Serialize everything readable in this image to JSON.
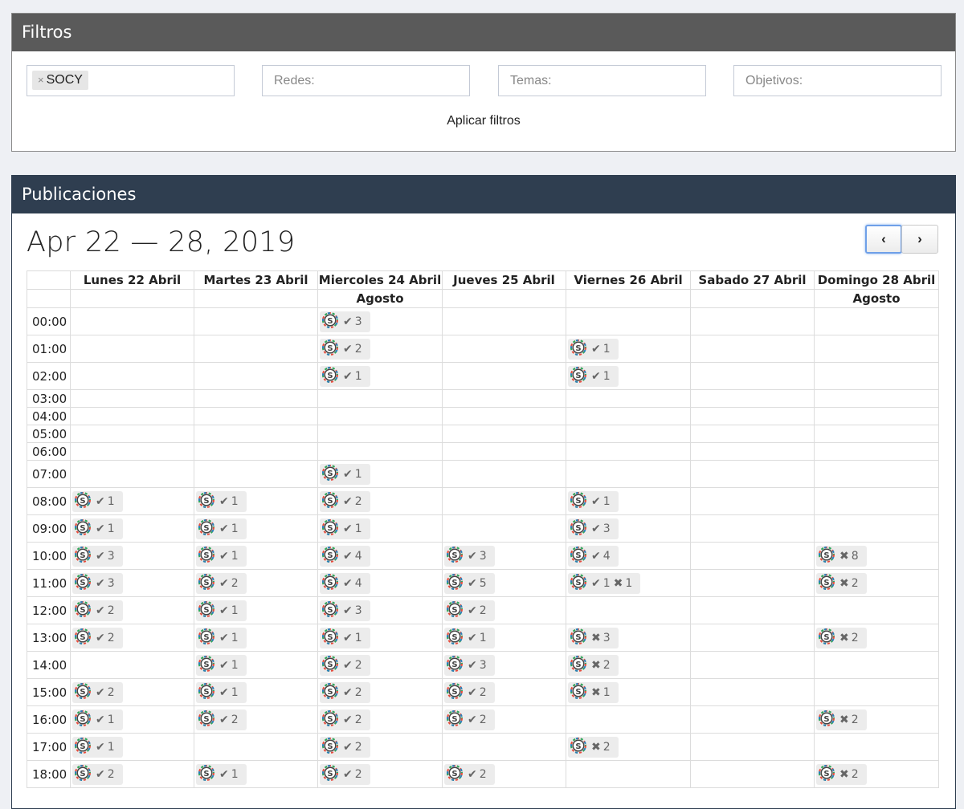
{
  "filters": {
    "title": "Filtros",
    "chip": "SOCY",
    "chip_remove": "×",
    "redes_placeholder": "Redes:",
    "temas_placeholder": "Temas:",
    "objetivos_placeholder": "Objetivos:",
    "apply_label": "Aplicar filtros"
  },
  "publications": {
    "title": "Publicaciones",
    "week_title": "Apr 22 — 28, 2019",
    "prev_icon": "‹",
    "next_icon": "›",
    "days": [
      {
        "label": "Lunes 22 Abril",
        "note": ""
      },
      {
        "label": "Martes 23 Abril",
        "note": ""
      },
      {
        "label": "Miercoles 24 Abril",
        "note": "Agosto"
      },
      {
        "label": "Jueves 25 Abril",
        "note": ""
      },
      {
        "label": "Viernes 26 Abril",
        "note": ""
      },
      {
        "label": "Sabado 27 Abril",
        "note": ""
      },
      {
        "label": "Domingo 28 Abril",
        "note": "Agosto"
      }
    ],
    "rows": [
      {
        "time": "00:00",
        "cells": [
          null,
          null,
          {
            "ok": "3"
          },
          null,
          null,
          null,
          null
        ]
      },
      {
        "time": "01:00",
        "cells": [
          null,
          null,
          {
            "ok": "2"
          },
          null,
          {
            "ok": "1"
          },
          null,
          null
        ]
      },
      {
        "time": "02:00",
        "cells": [
          null,
          null,
          {
            "ok": "1"
          },
          null,
          {
            "ok": "1"
          },
          null,
          null
        ]
      },
      {
        "time": "03:00",
        "cells": [
          null,
          null,
          null,
          null,
          null,
          null,
          null
        ]
      },
      {
        "time": "04:00",
        "cells": [
          null,
          null,
          null,
          null,
          null,
          null,
          null
        ]
      },
      {
        "time": "05:00",
        "cells": [
          null,
          null,
          null,
          null,
          null,
          null,
          null
        ]
      },
      {
        "time": "06:00",
        "cells": [
          null,
          null,
          null,
          null,
          null,
          null,
          null
        ]
      },
      {
        "time": "07:00",
        "cells": [
          null,
          null,
          {
            "ok": "1"
          },
          null,
          null,
          null,
          null
        ]
      },
      {
        "time": "08:00",
        "cells": [
          {
            "ok": "1"
          },
          {
            "ok": "1"
          },
          {
            "ok": "2"
          },
          null,
          {
            "ok": "1"
          },
          null,
          null
        ]
      },
      {
        "time": "09:00",
        "cells": [
          {
            "ok": "1"
          },
          {
            "ok": "1"
          },
          {
            "ok": "1"
          },
          null,
          {
            "ok": "3"
          },
          null,
          null
        ]
      },
      {
        "time": "10:00",
        "cells": [
          {
            "ok": "3"
          },
          {
            "ok": "1"
          },
          {
            "ok": "4"
          },
          {
            "ok": "3"
          },
          {
            "ok": "4"
          },
          null,
          {
            "fail": "8"
          }
        ]
      },
      {
        "time": "11:00",
        "cells": [
          {
            "ok": "3"
          },
          {
            "ok": "2"
          },
          {
            "ok": "4"
          },
          {
            "ok": "5"
          },
          {
            "ok": "1",
            "fail": "1"
          },
          null,
          {
            "fail": "2"
          }
        ]
      },
      {
        "time": "12:00",
        "cells": [
          {
            "ok": "2"
          },
          {
            "ok": "1"
          },
          {
            "ok": "3"
          },
          {
            "ok": "2"
          },
          null,
          null,
          null
        ]
      },
      {
        "time": "13:00",
        "cells": [
          {
            "ok": "2"
          },
          {
            "ok": "1"
          },
          {
            "ok": "1"
          },
          {
            "ok": "1"
          },
          {
            "fail": "3"
          },
          null,
          {
            "fail": "2"
          }
        ]
      },
      {
        "time": "14:00",
        "cells": [
          null,
          {
            "ok": "1"
          },
          {
            "ok": "2"
          },
          {
            "ok": "3"
          },
          {
            "fail": "2"
          },
          null,
          null
        ]
      },
      {
        "time": "15:00",
        "cells": [
          {
            "ok": "2"
          },
          {
            "ok": "1"
          },
          {
            "ok": "2"
          },
          {
            "ok": "2"
          },
          {
            "fail": "1"
          },
          null,
          null
        ]
      },
      {
        "time": "16:00",
        "cells": [
          {
            "ok": "1"
          },
          {
            "ok": "2"
          },
          {
            "ok": "2"
          },
          {
            "ok": "2"
          },
          null,
          null,
          {
            "fail": "2"
          }
        ]
      },
      {
        "time": "17:00",
        "cells": [
          {
            "ok": "1"
          },
          null,
          {
            "ok": "2"
          },
          null,
          {
            "fail": "2"
          },
          null,
          null
        ]
      },
      {
        "time": "18:00",
        "cells": [
          {
            "ok": "2"
          },
          {
            "ok": "1"
          },
          {
            "ok": "2"
          },
          {
            "ok": "2"
          },
          null,
          null,
          {
            "fail": "2"
          }
        ]
      }
    ]
  },
  "icons": {
    "badge_logo": "socy-logo-icon",
    "ok": "check-icon",
    "fail": "cross-icon"
  },
  "glyphs": {
    "ok": "✔",
    "fail": "✖"
  },
  "colors": {
    "filters_header": "#5a5a5a",
    "publications_header": "#2f3e50",
    "page_bg": "#eef0f4",
    "badge_bg": "#ececec"
  }
}
